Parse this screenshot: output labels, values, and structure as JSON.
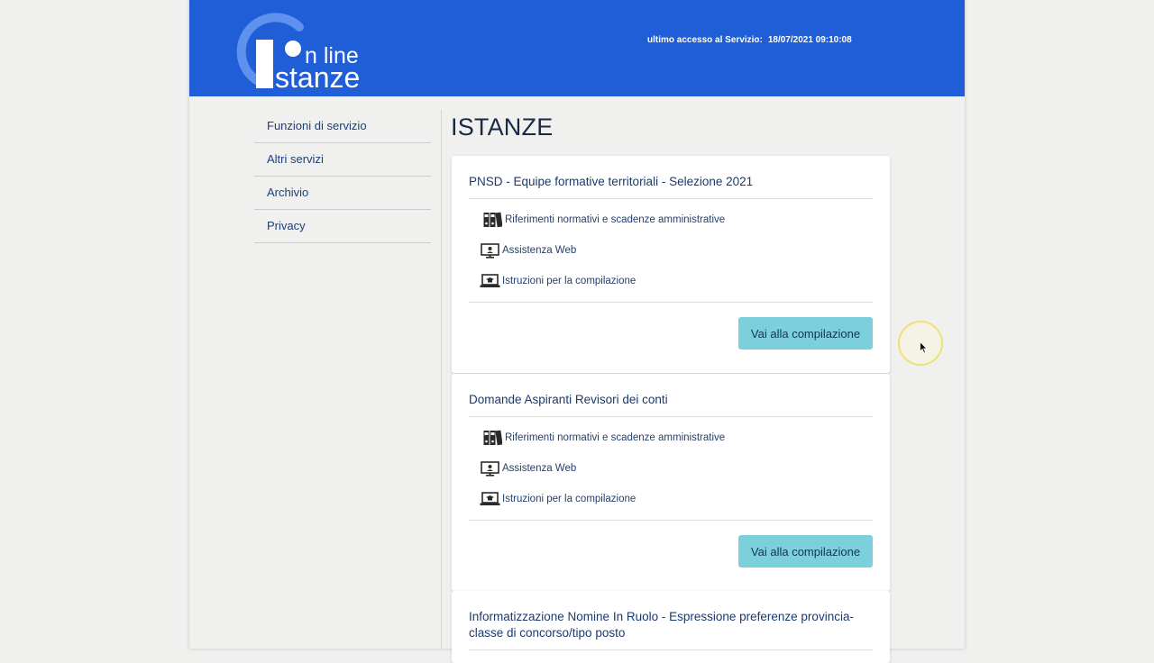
{
  "header": {
    "logo": {
      "word_top": "n line",
      "word_bottom": "stanze"
    },
    "last_access_label": "ultimo accesso al Servizio:",
    "last_access_value": "18/07/2021 09:10:08",
    "color": "#1f5ed6"
  },
  "sidebar": {
    "items": [
      {
        "label": "Funzioni di servizio"
      },
      {
        "label": "Altri servizi"
      },
      {
        "label": "Archivio"
      },
      {
        "label": "Privacy"
      }
    ]
  },
  "main": {
    "title": "ISTANZE",
    "cards": [
      {
        "title": "PNSD - Equipe formative territoriali - Selezione 2021",
        "links": {
          "riferimenti": "Riferimenti normativi e scadenze amministrative",
          "assistenza": "Assistenza Web",
          "istruzioni": "Istruzioni per la compilazione"
        },
        "button": "Vai alla compilazione"
      },
      {
        "title": "Domande Aspiranti Revisori dei conti",
        "links": {
          "riferimenti": "Riferimenti normativi e scadenze amministrative",
          "assistenza": "Assistenza Web",
          "istruzioni": "Istruzioni per la compilazione"
        },
        "button": "Vai alla compilazione"
      },
      {
        "title": "Informatizzazione Nomine In Ruolo - Espressione preferenze provincia-classe di concorso/tipo posto"
      }
    ]
  },
  "colors": {
    "button": "#7cd0db",
    "link_text": "#24406f",
    "background": "#f0f0ef"
  }
}
